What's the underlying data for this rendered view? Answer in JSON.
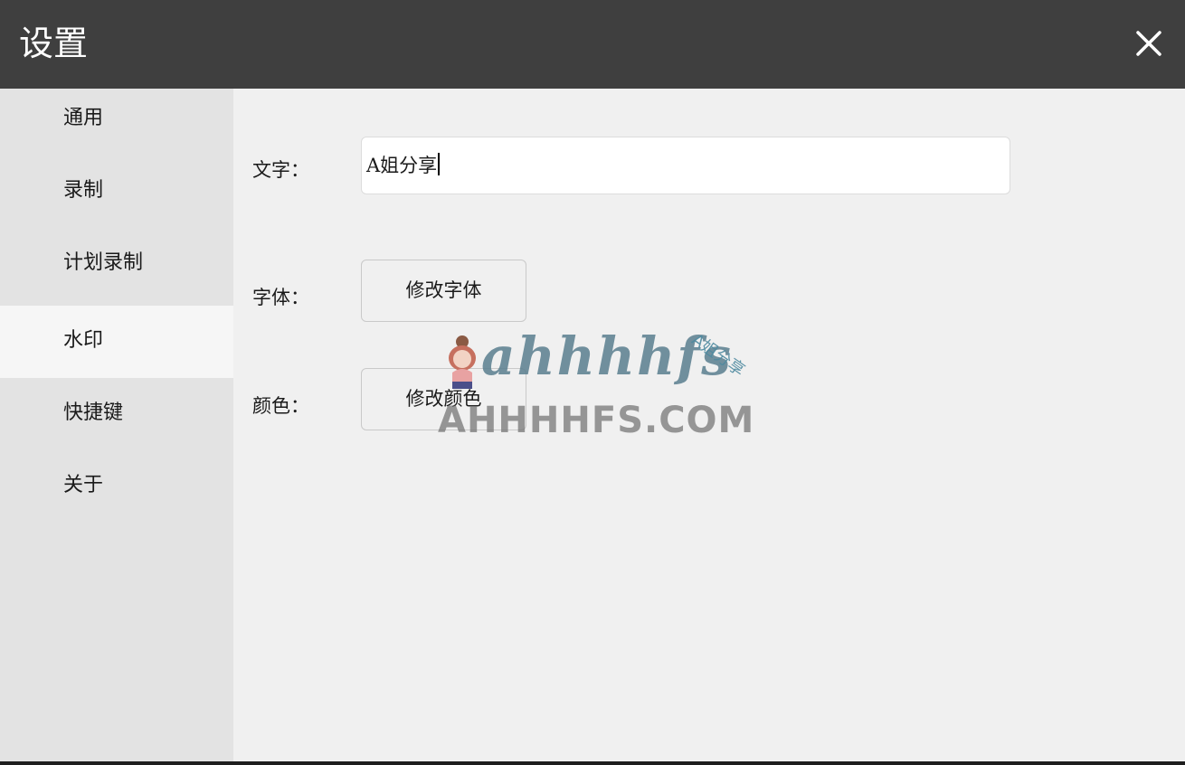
{
  "window": {
    "title": "设置",
    "close_icon": "close-icon"
  },
  "sidebar": {
    "items": [
      {
        "label": "通用",
        "active": false
      },
      {
        "label": "录制",
        "active": false
      },
      {
        "label": "计划录制",
        "active": false
      },
      {
        "label": "水印",
        "active": true
      },
      {
        "label": "快捷键",
        "active": false
      },
      {
        "label": "关于",
        "active": false
      }
    ]
  },
  "watermark_settings": {
    "text_label": "文字：",
    "text_value": "A姐分享",
    "font_label": "字体：",
    "font_button": "修改字体",
    "color_label": "颜色：",
    "color_button": "修改颜色"
  },
  "overlay_watermark": {
    "logo_text": "ahhhhfs",
    "tag_text": "A姐分享",
    "url_text": "AHHHHFS.COM"
  },
  "colors": {
    "titlebar": "#3f3f3f",
    "sidebar": "#e3e3e3",
    "sidebar_active": "#f6f6f6",
    "content_bg": "#f0f0f0"
  }
}
